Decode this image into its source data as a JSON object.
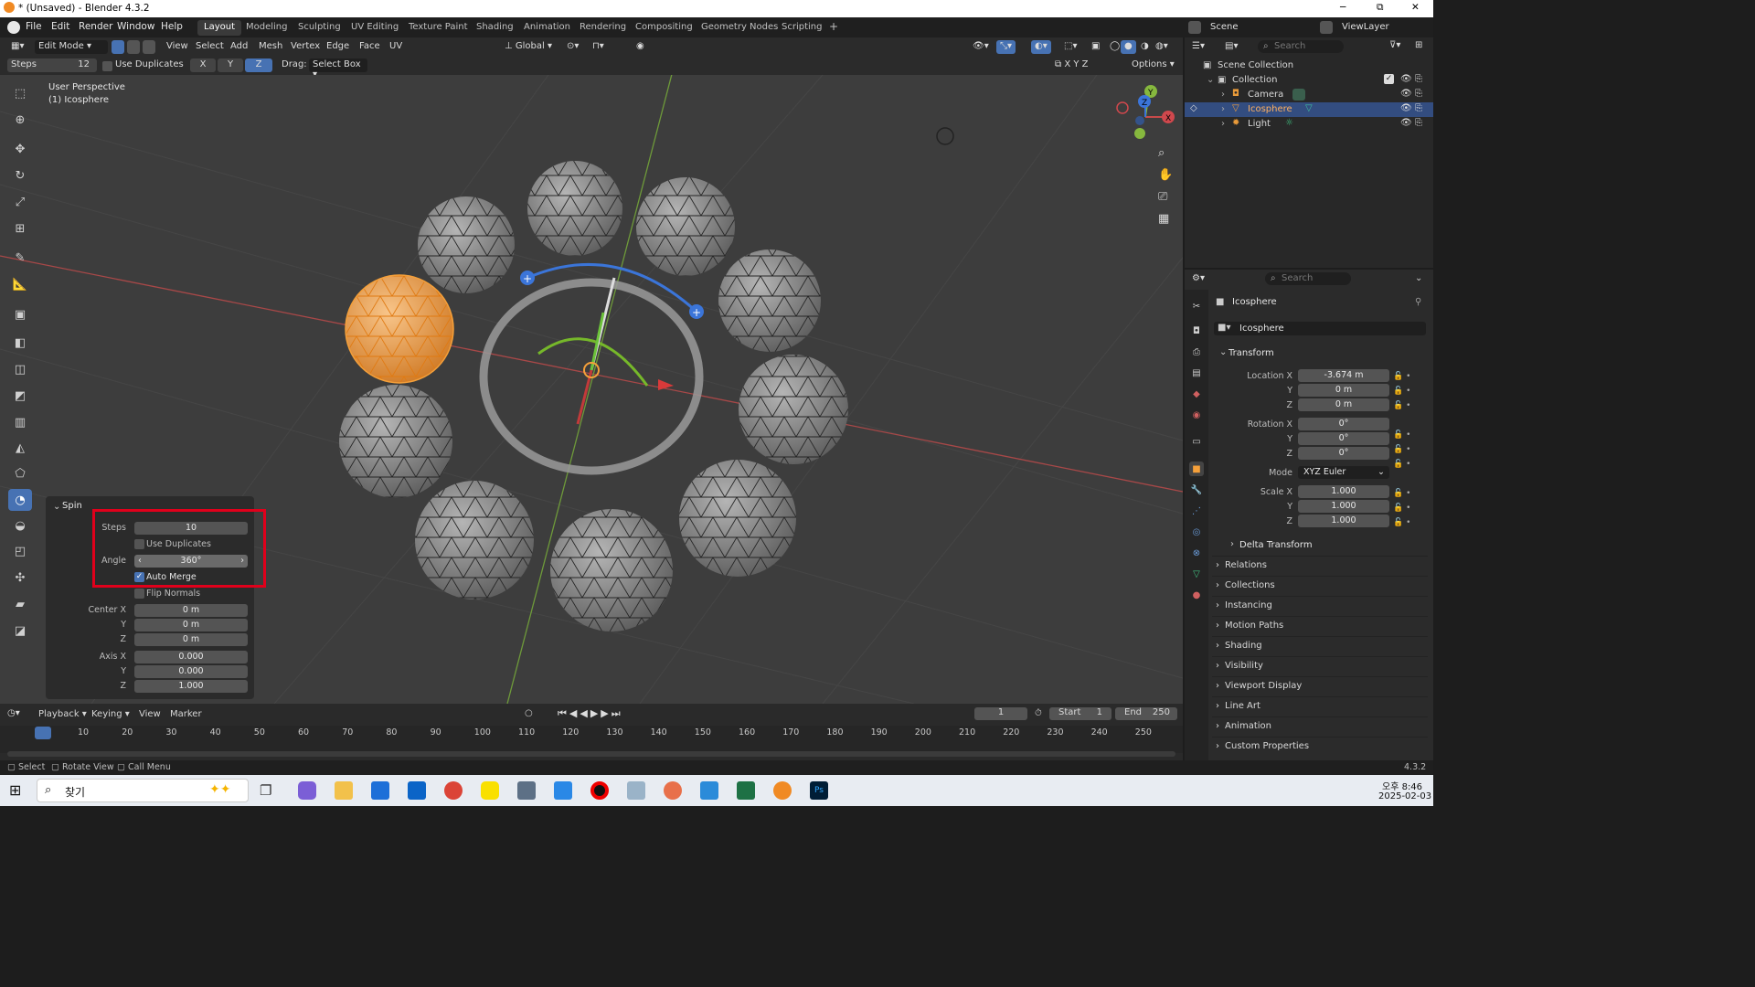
{
  "window": {
    "title": "* (Unsaved) - Blender 4.3.2",
    "minimize": "─",
    "maximize": "⧉",
    "close": "✕"
  },
  "menu": [
    "File",
    "Edit",
    "Render",
    "Window",
    "Help"
  ],
  "workspaces": [
    "Layout",
    "Modeling",
    "Sculpting",
    "UV Editing",
    "Texture Paint",
    "Shading",
    "Animation",
    "Rendering",
    "Compositing",
    "Geometry Nodes",
    "Scripting"
  ],
  "workspace_add": "+",
  "scene": {
    "name": "Scene",
    "view_layer": "ViewLayer"
  },
  "viewport_header": {
    "mode": "Edit Mode",
    "menus": [
      "View",
      "Select",
      "Add",
      "Mesh",
      "Vertex",
      "Edge",
      "Face",
      "UV"
    ],
    "orientation": "Global"
  },
  "tool_settings": {
    "steps_label": "Steps",
    "steps_value": "12",
    "use_duplicates": "Use Duplicates",
    "axes": [
      "X",
      "Y",
      "Z"
    ],
    "drag_label": "Drag:",
    "drag_value": "Select Box",
    "options": "Options"
  },
  "viewport": {
    "perspective": "User Perspective",
    "object": "(1) Icosphere"
  },
  "spin_panel": {
    "title": "Spin",
    "steps_label": "Steps",
    "steps": "10",
    "use_duplicates": "Use Duplicates",
    "use_duplicates_checked": false,
    "angle_label": "Angle",
    "angle": "360°",
    "auto_merge": "Auto Merge",
    "auto_merge_checked": true,
    "flip_normals": "Flip Normals",
    "flip_normals_checked": false,
    "center_x_label": "Center X",
    "center_x": "0 m",
    "center_y_label": "Y",
    "center_y": "0 m",
    "center_z_label": "Z",
    "center_z": "0 m",
    "axis_x_label": "Axis X",
    "axis_x": "0.000",
    "axis_y_label": "Y",
    "axis_y": "0.000",
    "axis_z_label": "Z",
    "axis_z": "1.000",
    "highlight_color": "#e0001b"
  },
  "outliner": {
    "search_placeholder": "Search",
    "root": "Scene Collection",
    "collection": "Collection",
    "items": [
      {
        "name": "Camera",
        "selected": false
      },
      {
        "name": "Icosphere",
        "selected": true
      },
      {
        "name": "Light",
        "selected": false
      }
    ]
  },
  "properties": {
    "search_placeholder": "Search",
    "object_name": "Icosphere",
    "datablock": "Icosphere",
    "transform": "Transform",
    "location_x_label": "Location X",
    "location_x": "-3.674 m",
    "location_y_label": "Y",
    "location_y": "0 m",
    "location_z_label": "Z",
    "location_z": "0 m",
    "rotation_x_label": "Rotation X",
    "rotation_x": "0°",
    "rotation_y_label": "Y",
    "rotation_y": "0°",
    "rotation_z_label": "Z",
    "rotation_z": "0°",
    "mode_label": "Mode",
    "mode": "XYZ Euler",
    "scale_x_label": "Scale X",
    "scale_x": "1.000",
    "scale_y_label": "Y",
    "scale_y": "1.000",
    "scale_z_label": "Z",
    "scale_z": "1.000",
    "delta_transform": "Delta Transform",
    "sections": [
      "Relations",
      "Collections",
      "Instancing",
      "Motion Paths",
      "Shading",
      "Visibility",
      "Viewport Display",
      "Line Art",
      "Animation",
      "Custom Properties"
    ]
  },
  "timeline": {
    "menus": [
      "Playback",
      "Keying",
      "View",
      "Marker"
    ],
    "current_frame": "1",
    "start_label": "Start",
    "start": "1",
    "end_label": "End",
    "end": "250",
    "ticks": [
      "1",
      "10",
      "20",
      "30",
      "40",
      "50",
      "60",
      "70",
      "80",
      "90",
      "100",
      "110",
      "120",
      "130",
      "140",
      "150",
      "160",
      "170",
      "180",
      "190",
      "200",
      "210",
      "220",
      "230",
      "240",
      "250"
    ]
  },
  "statusbar": {
    "select": "Select",
    "rotate": "Rotate View",
    "call_menu": "Call Menu",
    "version": "4.3.2"
  },
  "taskbar": {
    "search": "찾기",
    "time": "오후 8:46",
    "date": "2025-02-03"
  },
  "colors": {
    "accent": "#4772b3",
    "selection_orange": "#f5a03a",
    "x_axis": "#c84a4a",
    "y_axis": "#80b33a"
  }
}
